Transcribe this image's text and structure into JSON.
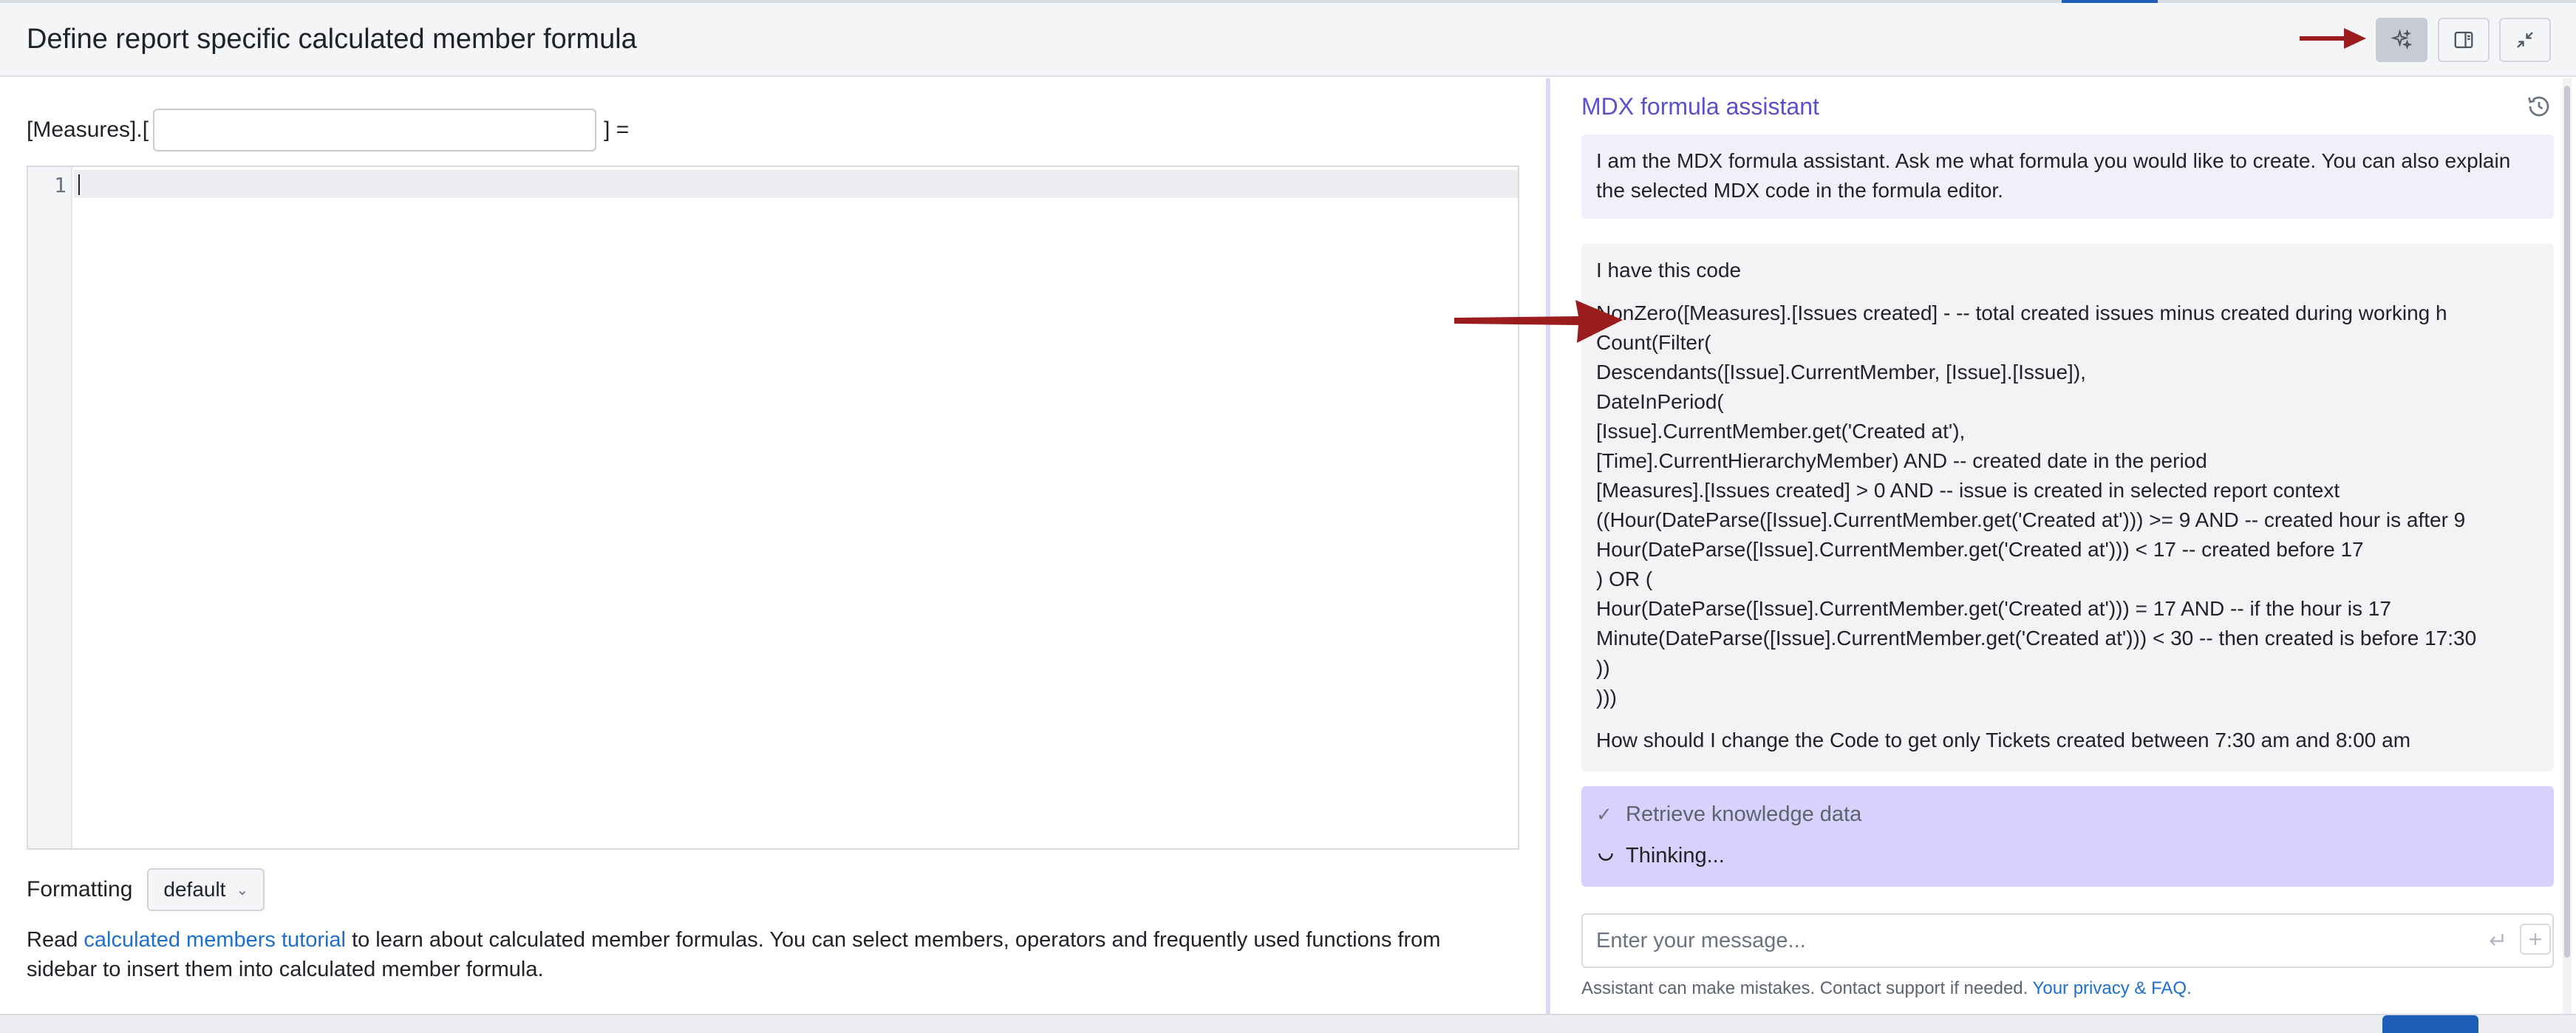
{
  "header": {
    "title": "Define report specific calculated member formula"
  },
  "editor": {
    "measure_prefix": "[Measures].[",
    "measure_suffix": "] =",
    "name_value": "",
    "line_number": "1"
  },
  "formatting": {
    "label": "Formatting",
    "selected": "default"
  },
  "help": {
    "prefix": "Read",
    "link": "calculated members tutorial",
    "suffix": "to learn about calculated member formulas. You can select members, operators and frequently used functions from sidebar to insert them into calculated member formula."
  },
  "assistant": {
    "title": "MDX formula assistant",
    "intro": "I am the MDX formula assistant. Ask me what formula you would like to create. You can also explain the selected MDX code in the formula editor.",
    "user_message": {
      "lead": "I have this code",
      "code_lines": [
        "NonZero([Measures].[Issues created] - -- total created issues minus created during working h",
        "Count(Filter(",
        "Descendants([Issue].CurrentMember, [Issue].[Issue]),",
        "DateInPeriod(",
        "[Issue].CurrentMember.get('Created at'),",
        "[Time].CurrentHierarchyMember) AND -- created date in the period",
        "[Measures].[Issues created] > 0 AND -- issue is created in selected report context",
        "((Hour(DateParse([Issue].CurrentMember.get('Created at'))) >= 9 AND -- created hour is after 9",
        "Hour(DateParse([Issue].CurrentMember.get('Created at'))) < 17 -- created before 17",
        ") OR (",
        "Hour(DateParse([Issue].CurrentMember.get('Created at'))) = 17 AND -- if the hour is 17",
        "Minute(DateParse([Issue].CurrentMember.get('Created at'))) < 30 -- then created is before 17:30",
        "))",
        ")))"
      ],
      "question": "How should I change the Code to get only Tickets created between 7:30 am and 8:00 am"
    },
    "status": {
      "step_done": "Retrieve knowledge data",
      "step_active": "Thinking..."
    },
    "input_placeholder": "Enter your message...",
    "disclaimer": "Assistant can make mistakes. Contact support if needed.",
    "privacy_link": "Your privacy & FAQ."
  },
  "colors": {
    "accent": "#5b4ed1",
    "link": "#1d6fce",
    "arrow": "#9b1c1c"
  }
}
